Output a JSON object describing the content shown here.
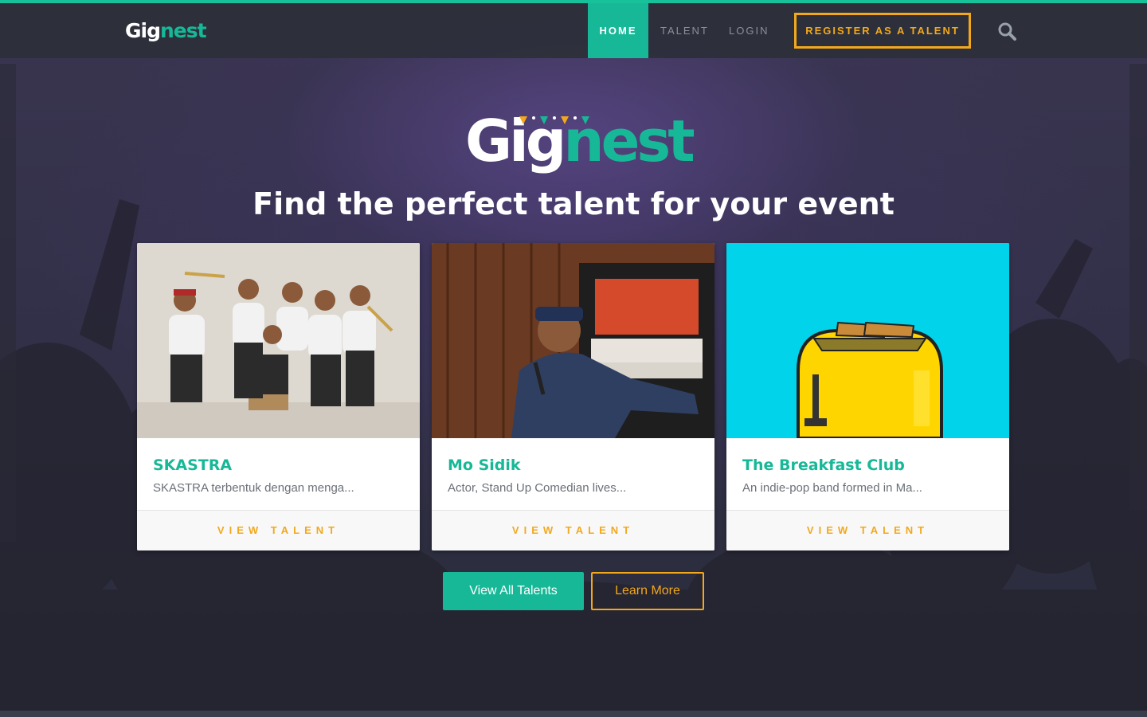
{
  "brand": {
    "name_part1": "Gig",
    "name_part2": "nest",
    "primary_color": "#17b897",
    "accent_color": "#f3a81b"
  },
  "nav": {
    "items": [
      {
        "label": "HOME",
        "active": true
      },
      {
        "label": "TALENT",
        "active": false
      },
      {
        "label": "LOGIN",
        "active": false
      }
    ],
    "register_label": "REGISTER AS A TALENT",
    "search_icon": "search-icon"
  },
  "hero": {
    "title": "Find the perfect talent for your event"
  },
  "cards": [
    {
      "title": "SKASTRA",
      "description": "SKASTRA terbentuk dengan menga...",
      "button_label": "VIEW TALENT",
      "image": "band-photo"
    },
    {
      "title": "Mo Sidik",
      "description": "Actor, Stand Up Comedian lives...",
      "button_label": "VIEW TALENT",
      "image": "comedian-photo"
    },
    {
      "title": "The Breakfast Club",
      "description": "An indie-pop band formed in Ma...",
      "button_label": "VIEW TALENT",
      "image": "pixel-toaster"
    }
  ],
  "actions": {
    "view_all_label": "View All Talents",
    "learn_more_label": "Learn More"
  }
}
